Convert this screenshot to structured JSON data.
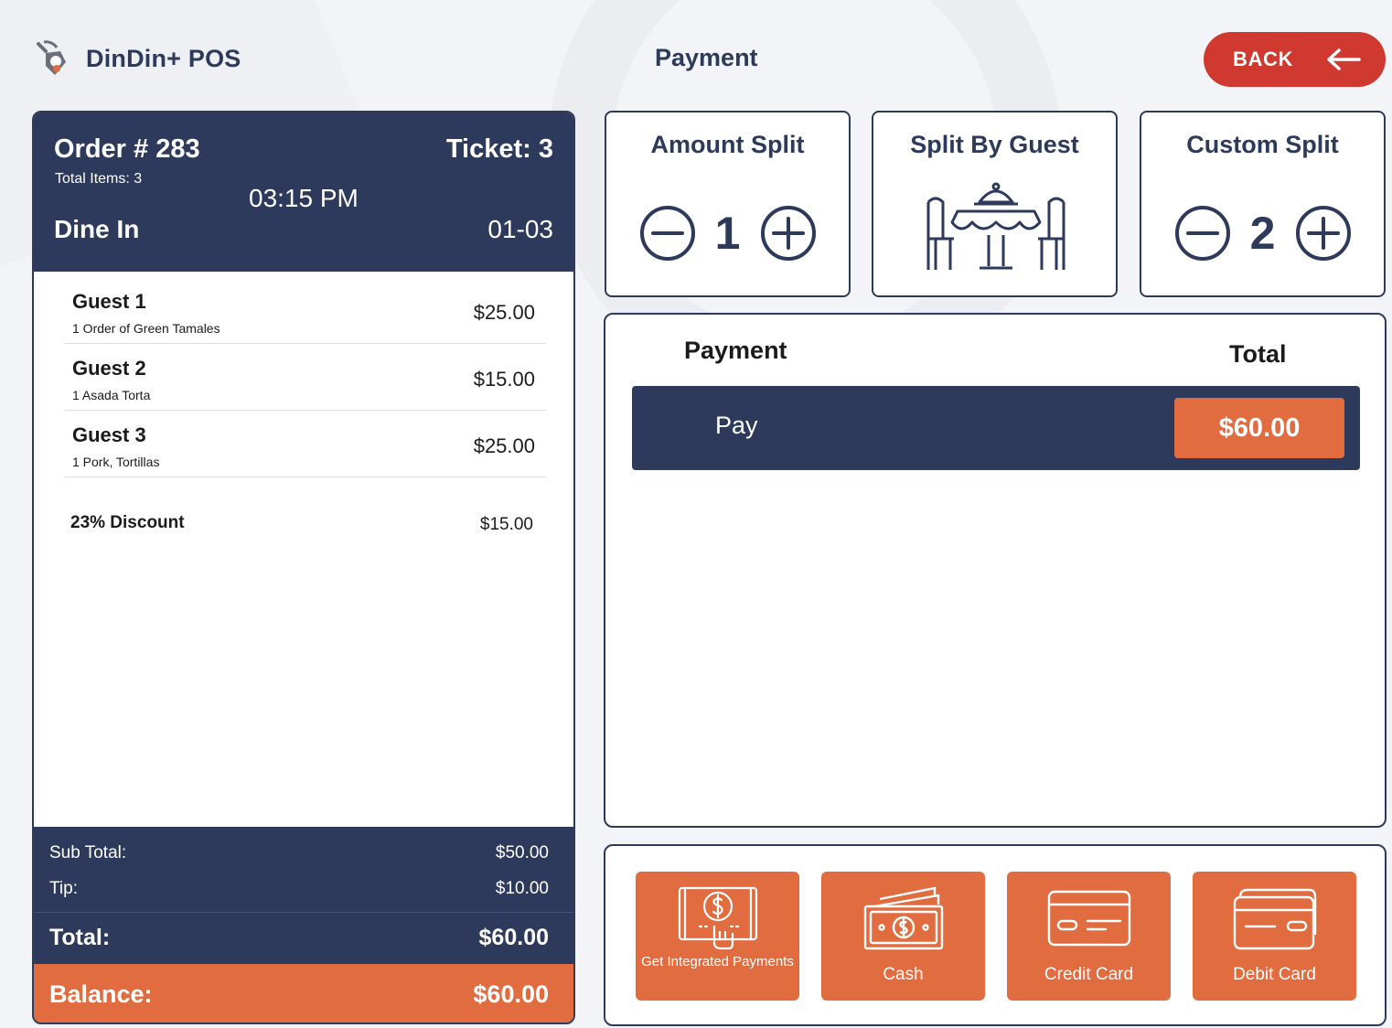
{
  "app": {
    "brand": "DinDin+ POS",
    "page_title": "Payment",
    "back_label": "BACK"
  },
  "order": {
    "number": "Order # 283",
    "total_items": "Total Items: 3",
    "ticket": "Ticket: 3",
    "time": "03:15 PM",
    "type": "Dine In",
    "table": "01-03",
    "guests": [
      {
        "name": "Guest 1",
        "item": "1  Order of Green Tamales",
        "price": "$25.00"
      },
      {
        "name": "Guest 2",
        "item": "1  Asada Torta",
        "price": "$15.00"
      },
      {
        "name": "Guest 3",
        "item": "1  Pork, Tortillas",
        "price": "$25.00"
      }
    ],
    "discount_label": "23% Discount",
    "discount_value": "$15.00",
    "subtotal_label": "Sub Total:",
    "subtotal_value": "$50.00",
    "tip_label": "Tip:",
    "tip_value": "$10.00",
    "total_label": "Total:",
    "total_value": "$60.00",
    "balance_label": "Balance:",
    "balance_value": "$60.00"
  },
  "split": {
    "amount": {
      "title": "Amount Split",
      "value": "1"
    },
    "guest": {
      "title": "Split By Guest"
    },
    "custom": {
      "title": "Custom Split",
      "value": "2"
    }
  },
  "payment": {
    "col_payment": "Payment",
    "col_total": "Total",
    "row_label": "Pay",
    "row_amount": "$60.00"
  },
  "methods": [
    {
      "label": "Get Integrated Payments",
      "icon": "integrated-payment-icon"
    },
    {
      "label": "Cash",
      "icon": "cash-icon"
    },
    {
      "label": "Credit Card",
      "icon": "credit-card-icon"
    },
    {
      "label": "Debit Card",
      "icon": "debit-card-icon"
    }
  ],
  "colors": {
    "navy": "#2e3a5b",
    "orange": "#e16c40",
    "back_red": "#d0392f"
  }
}
